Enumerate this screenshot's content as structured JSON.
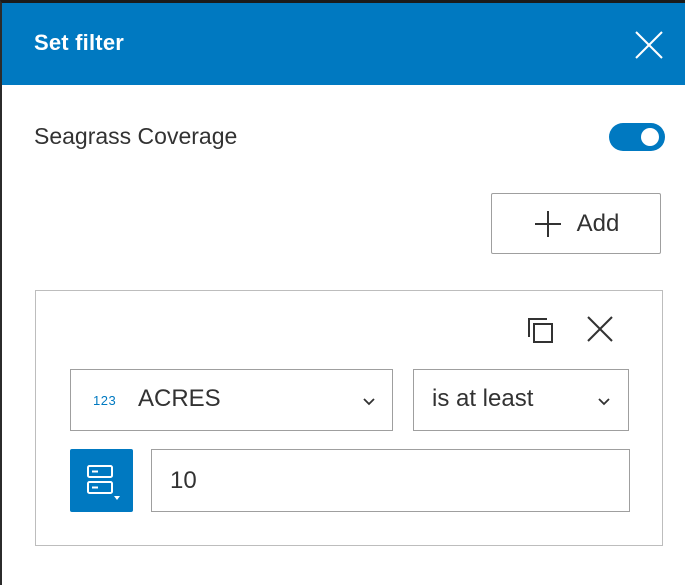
{
  "header": {
    "title": "Set filter"
  },
  "layer": {
    "name": "Seagrass Coverage",
    "enabled": true
  },
  "toolbar": {
    "add_label": "Add"
  },
  "expression": {
    "field_type": "123",
    "field_name": "ACRES",
    "operator": "is at least",
    "value": "10"
  },
  "colors": {
    "accent": "#0079c1",
    "text": "#323232",
    "border": "#9f9f9f"
  },
  "icons": {
    "close": "close-icon",
    "add": "plus-icon",
    "duplicate": "copy-icon",
    "remove": "close-icon",
    "dropdown": "chevron-down-icon",
    "value_mode": "list-mode-icon"
  }
}
